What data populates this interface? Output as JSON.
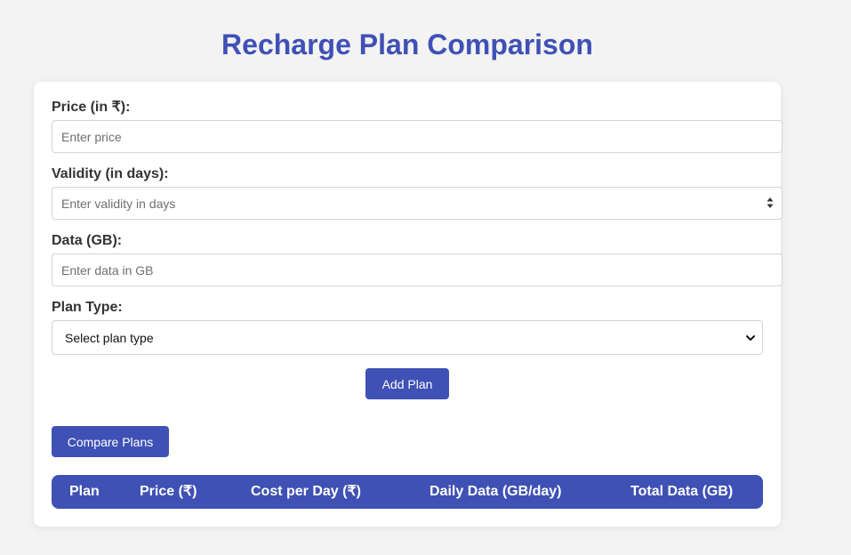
{
  "page": {
    "title": "Recharge Plan Comparison"
  },
  "form": {
    "price": {
      "label": "Price (in ₹):",
      "value": "",
      "placeholder": "Enter price"
    },
    "validity": {
      "label": "Validity (in days):",
      "value": "",
      "placeholder": "Enter validity in days"
    },
    "data": {
      "label": "Data (GB):",
      "value": "",
      "placeholder": "Enter data in GB"
    },
    "plan_type": {
      "label": "Plan Type:",
      "selected": "Select plan type"
    },
    "add_button": "Add Plan"
  },
  "compare_button": "Compare Plans",
  "table": {
    "headers": [
      "Plan",
      "Price (₹)",
      "Cost per Day (₹)",
      "Daily Data (GB/day)",
      "Total Data (GB)"
    ]
  },
  "colors": {
    "accent": "#3f51b5",
    "background": "#f3f3f3",
    "card": "#ffffff"
  },
  "icons": {
    "spinner": "number-spinner-icon",
    "chevron": "chevron-down-icon"
  }
}
